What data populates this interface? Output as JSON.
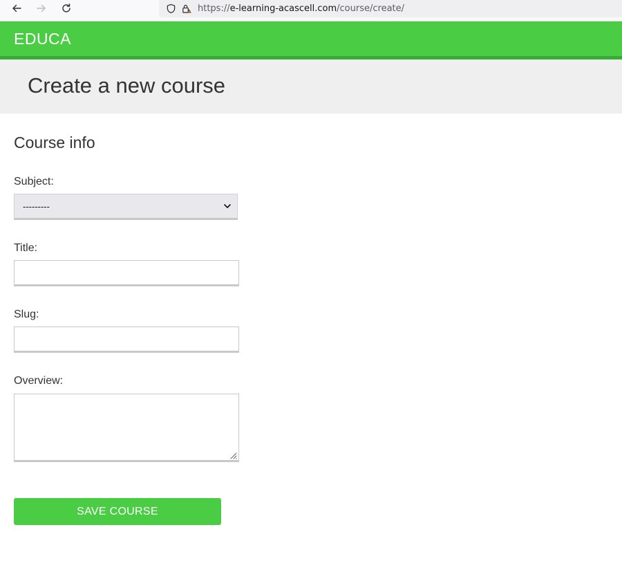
{
  "browser": {
    "url_prefix": "https://",
    "url_host": "e-learning-acascell.com",
    "url_path": "/course/create/",
    "icons": [
      "back-icon",
      "forward-icon",
      "reload-icon",
      "shield-icon",
      "lock-icon"
    ]
  },
  "header": {
    "logo": "EDUCA",
    "accent_color": "#4bcc45"
  },
  "page": {
    "title": "Create a new course"
  },
  "form": {
    "section_title": "Course info",
    "subject_label": "Subject:",
    "subject_value": "---------",
    "title_label": "Title:",
    "title_value": "",
    "slug_label": "Slug:",
    "slug_value": "",
    "overview_label": "Overview:",
    "overview_value": "",
    "submit_label": "SAVE COURSE"
  }
}
